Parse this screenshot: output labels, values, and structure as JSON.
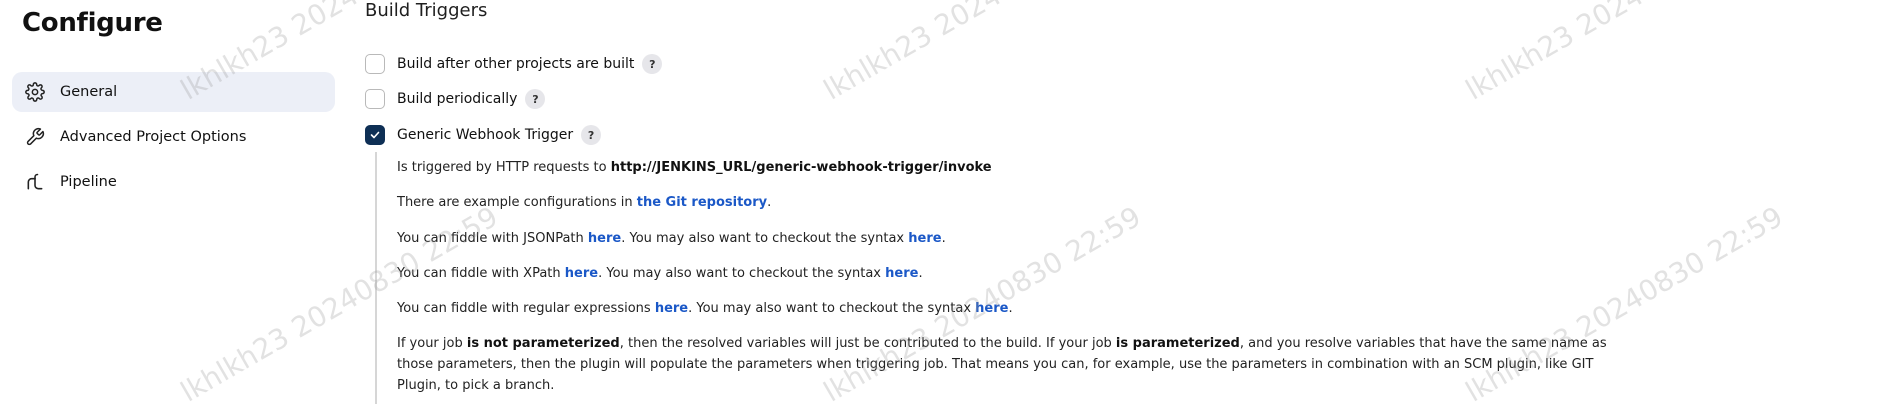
{
  "sidebar": {
    "title": "Configure",
    "items": [
      {
        "label": "General",
        "icon": "gear-icon",
        "active": true
      },
      {
        "label": "Advanced Project Options",
        "icon": "wrench-icon",
        "active": false
      },
      {
        "label": "Pipeline",
        "icon": "pipeline-icon",
        "active": false
      }
    ]
  },
  "main": {
    "section_title": "Build Triggers",
    "triggers": [
      {
        "label": "Build after other projects are built",
        "checked": false,
        "help": "?"
      },
      {
        "label": "Build periodically",
        "checked": false,
        "help": "?"
      },
      {
        "label": "Generic Webhook Trigger",
        "checked": true,
        "help": "?"
      }
    ],
    "description": {
      "p1_prefix": "Is triggered by HTTP requests to ",
      "p1_url": "http://JENKINS_URL/generic-webhook-trigger/invoke",
      "p2_prefix": "There are example configurations in ",
      "p2_link": "the Git repository",
      "p2_suffix": ".",
      "p3_prefix": "You can fiddle with JSONPath ",
      "p3_link1": "here",
      "p3_mid": ". You may also want to checkout the syntax ",
      "p3_link2": "here",
      "p3_suffix": ".",
      "p4_prefix": "You can fiddle with XPath ",
      "p4_link1": "here",
      "p4_mid": ". You may also want to checkout the syntax ",
      "p4_link2": "here",
      "p4_suffix": ".",
      "p5_prefix": "You can fiddle with regular expressions ",
      "p5_link1": "here",
      "p5_mid": ". You may also want to checkout the syntax ",
      "p5_link2": "here",
      "p5_suffix": ".",
      "p6_a": "If your job ",
      "p6_b": "is not parameterized",
      "p6_c": ", then the resolved variables will just be contributed to the build. If your job ",
      "p6_d": "is parameterized",
      "p6_e": ", and you resolve variables that have the same name as those parameters, then the plugin will populate the parameters when triggering job. That means you can, for example, use the parameters in combination with an SCM plugin, like GIT Plugin, to pick a branch."
    }
  },
  "watermark": {
    "text_a": "lkhlkh23 20240830 22:59",
    "color": "#969696"
  },
  "colors": {
    "active_nav_bg": "#eceff7",
    "checkbox_checked": "#0e2f55",
    "link": "#1b58c7"
  }
}
